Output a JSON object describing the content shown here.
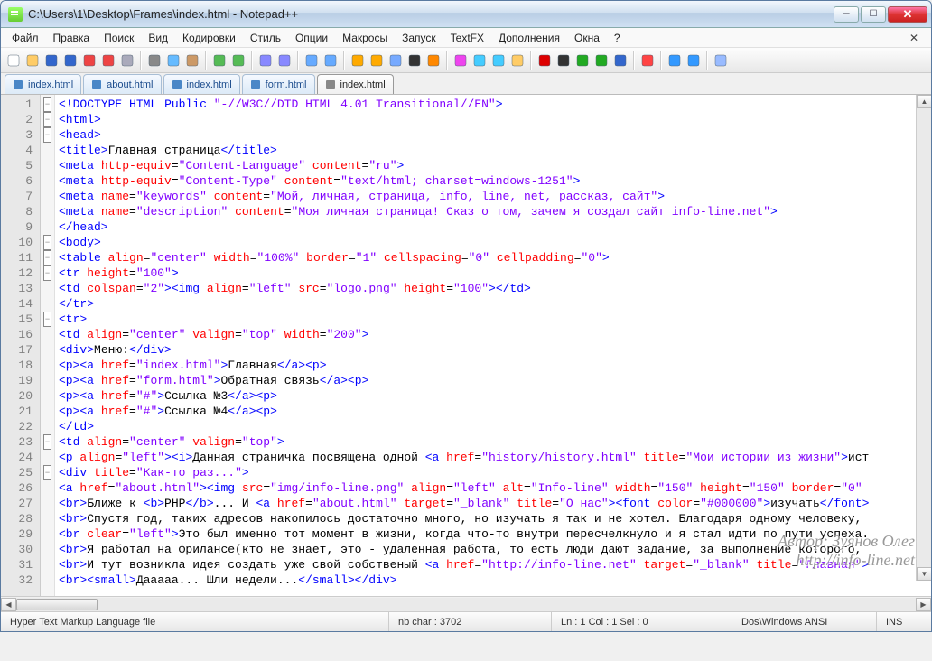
{
  "window": {
    "title": "C:\\Users\\1\\Desktop\\Frames\\index.html - Notepad++"
  },
  "menu": {
    "items": [
      "Файл",
      "Правка",
      "Поиск",
      "Вид",
      "Кодировки",
      "Стиль",
      "Опции",
      "Макросы",
      "Запуск",
      "TextFX",
      "Дополнения",
      "Окна",
      "?"
    ],
    "close_glyph": "✕"
  },
  "toolbar_icons": [
    "new-file",
    "open-file",
    "save-file",
    "save-all",
    "close-file",
    "close-all",
    "print",
    "sep",
    "cut",
    "copy",
    "paste",
    "sep",
    "undo",
    "redo",
    "sep",
    "find",
    "replace",
    "sep",
    "zoom-in",
    "zoom-out",
    "sep",
    "sync-v",
    "sync-h",
    "wrap",
    "all-chars",
    "indent-guide",
    "sep",
    "lang-udl",
    "doc-map",
    "func-list",
    "folder",
    "sep",
    "macro-rec",
    "macro-stop",
    "macro-play",
    "macro-play-multi",
    "macro-save",
    "sep",
    "toggle-ff",
    "sep",
    "outdent",
    "indent",
    "sep",
    "clipboard-hist"
  ],
  "tabs": [
    {
      "label": "index.html",
      "active": false
    },
    {
      "label": "about.html",
      "active": false
    },
    {
      "label": "index.html",
      "active": false
    },
    {
      "label": "form.html",
      "active": false
    },
    {
      "label": "index.html",
      "active": true
    }
  ],
  "line_count_start": 1,
  "fold_lines": [
    1,
    2,
    3,
    10,
    11,
    12,
    15,
    23,
    25
  ],
  "code_lines": [
    {
      "indent": 0,
      "html": "<span class='t-blue'>&lt;!</span><span class='t-blue'>DOCTYPE</span> <span class='t-blue'>HTML</span> <span class='t-blue'>Public</span> <span class='t-purple'>\"-//W3C//DTD HTML 4.01 Transitional//EN\"</span><span class='t-blue'>&gt;</span>"
    },
    {
      "indent": 0,
      "html": "<span class='t-blue'>&lt;html&gt;</span>"
    },
    {
      "indent": 0,
      "html": "<span class='t-blue'>&lt;head&gt;</span>"
    },
    {
      "indent": 0,
      "html": "<span class='t-blue'>&lt;title&gt;</span><span class='t-black'>Главная страница</span><span class='t-blue'>&lt;/title&gt;</span>"
    },
    {
      "indent": 0,
      "html": "<span class='t-blue'>&lt;meta</span> <span class='t-red'>http-equiv</span>=<span class='t-purple'>\"Content-Language\"</span> <span class='t-red'>content</span>=<span class='t-purple'>\"ru\"</span><span class='t-blue'>&gt;</span>"
    },
    {
      "indent": 0,
      "html": "<span class='t-blue'>&lt;meta</span> <span class='t-red'>http-equiv</span>=<span class='t-purple'>\"Content-Type\"</span> <span class='t-red'>content</span>=<span class='t-purple'>\"text/html; charset=windows-1251\"</span><span class='t-blue'>&gt;</span>"
    },
    {
      "indent": 0,
      "html": "<span class='t-blue'>&lt;meta</span> <span class='t-red'>name</span>=<span class='t-purple'>\"keywords\"</span> <span class='t-red'>content</span>=<span class='t-purple'>\"Мой, личная, страница, info, line, net, рассказ, сайт\"</span><span class='t-blue'>&gt;</span>"
    },
    {
      "indent": 0,
      "html": "<span class='t-blue'>&lt;meta</span> <span class='t-red'>name</span>=<span class='t-purple'>\"description\"</span> <span class='t-red'>content</span>=<span class='t-purple'>\"Моя личная страница! Сказ о том, зачем я создал сайт info-line.net\"</span><span class='t-blue'>&gt;</span>"
    },
    {
      "indent": 0,
      "html": "<span class='t-blue'>&lt;/head&gt;</span>"
    },
    {
      "indent": 0,
      "html": "<span class='t-blue'>&lt;body&gt;</span>"
    },
    {
      "indent": 0,
      "html": "<span class='t-blue'>&lt;table</span> <span class='t-red'>align</span>=<span class='t-purple'>\"center\"</span> <span class='t-red'>wi<span class='caret'></span>dth</span>=<span class='t-purple'>\"100%\"</span> <span class='t-red'>border</span>=<span class='t-purple'>\"1\"</span> <span class='t-red'>cellspacing</span>=<span class='t-purple'>\"0\"</span> <span class='t-red'>cellpadding</span>=<span class='t-purple'>\"0\"</span><span class='t-blue'>&gt;</span>"
    },
    {
      "indent": 0,
      "html": "<span class='t-blue'>&lt;tr</span> <span class='t-red'>height</span>=<span class='t-purple'>\"100\"</span><span class='t-blue'>&gt;</span>"
    },
    {
      "indent": 0,
      "html": "<span class='t-blue'>&lt;td</span> <span class='t-red'>colspan</span>=<span class='t-purple'>\"2\"</span><span class='t-blue'>&gt;&lt;img</span> <span class='t-red'>align</span>=<span class='t-purple'>\"left\"</span> <span class='t-red'>src</span>=<span class='t-purple'>\"logo.png\"</span> <span class='t-red'>height</span>=<span class='t-purple'>\"100\"</span><span class='t-blue'>&gt;&lt;/td&gt;</span>"
    },
    {
      "indent": 0,
      "html": "<span class='t-blue'>&lt;/tr&gt;</span>"
    },
    {
      "indent": 0,
      "html": "<span class='t-blue'>&lt;tr&gt;</span>"
    },
    {
      "indent": 0,
      "html": "<span class='t-blue'>&lt;td</span> <span class='t-red'>align</span>=<span class='t-purple'>\"center\"</span> <span class='t-red'>valign</span>=<span class='t-purple'>\"top\"</span> <span class='t-red'>width</span>=<span class='t-purple'>\"200\"</span><span class='t-blue'>&gt;</span>"
    },
    {
      "indent": 0,
      "html": "<span class='t-blue'>&lt;div&gt;</span><span class='t-black'>Меню:</span><span class='t-blue'>&lt;/div&gt;</span>"
    },
    {
      "indent": 0,
      "html": "<span class='t-blue'>&lt;p&gt;&lt;a</span> <span class='t-red'>href</span>=<span class='t-purple'>\"index.html\"</span><span class='t-blue'>&gt;</span><span class='t-black'>Главная</span><span class='t-blue'>&lt;/a&gt;&lt;p&gt;</span>"
    },
    {
      "indent": 0,
      "html": "<span class='t-blue'>&lt;p&gt;&lt;a</span> <span class='t-red'>href</span>=<span class='t-purple'>\"form.html\"</span><span class='t-blue'>&gt;</span><span class='t-black'>Обратная связь</span><span class='t-blue'>&lt;/a&gt;&lt;p&gt;</span>"
    },
    {
      "indent": 0,
      "html": "<span class='t-blue'>&lt;p&gt;&lt;a</span> <span class='t-red'>href</span>=<span class='t-purple'>\"#\"</span><span class='t-blue'>&gt;</span><span class='t-black'>Ссылка №3</span><span class='t-blue'>&lt;/a&gt;&lt;p&gt;</span>"
    },
    {
      "indent": 0,
      "html": "<span class='t-blue'>&lt;p&gt;&lt;a</span> <span class='t-red'>href</span>=<span class='t-purple'>\"#\"</span><span class='t-blue'>&gt;</span><span class='t-black'>Ссылка №4</span><span class='t-blue'>&lt;/a&gt;&lt;p&gt;</span>"
    },
    {
      "indent": 0,
      "html": "<span class='t-blue'>&lt;/td&gt;</span>"
    },
    {
      "indent": 0,
      "html": "<span class='t-blue'>&lt;td</span> <span class='t-red'>align</span>=<span class='t-purple'>\"center\"</span> <span class='t-red'>valign</span>=<span class='t-purple'>\"top\"</span><span class='t-blue'>&gt;</span>"
    },
    {
      "indent": 0,
      "html": "<span class='t-blue'>&lt;p</span> <span class='t-red'>align</span>=<span class='t-purple'>\"left\"</span><span class='t-blue'>&gt;&lt;i&gt;</span><span class='t-black'>Данная страничка посвящена одной </span><span class='t-blue'>&lt;a</span> <span class='t-red'>href</span>=<span class='t-purple'>\"history/history.html\"</span> <span class='t-red'>title</span>=<span class='t-purple'>\"Мои истории из жизни\"</span><span class='t-blue'>&gt;</span><span class='t-black'>ист</span>"
    },
    {
      "indent": 0,
      "html": "<span class='t-blue'>&lt;div</span> <span class='t-red'>title</span>=<span class='t-purple'>\"Как-то раз...\"</span><span class='t-blue'>&gt;</span>"
    },
    {
      "indent": 0,
      "html": "<span class='t-blue'>&lt;a</span> <span class='t-red'>href</span>=<span class='t-purple'>\"about.html\"</span><span class='t-blue'>&gt;&lt;img</span> <span class='t-red'>src</span>=<span class='t-purple'>\"img/info-line.png\"</span> <span class='t-red'>align</span>=<span class='t-purple'>\"left\"</span> <span class='t-red'>alt</span>=<span class='t-purple'>\"Info-line\"</span> <span class='t-red'>width</span>=<span class='t-purple'>\"150\"</span> <span class='t-red'>height</span>=<span class='t-purple'>\"150\"</span> <span class='t-red'>border</span>=<span class='t-purple'>\"0\"</span>"
    },
    {
      "indent": 0,
      "html": "<span class='t-blue'>&lt;br&gt;</span><span class='t-black'>Ближе к </span><span class='t-blue'>&lt;b&gt;</span><span class='t-black'>PHP</span><span class='t-blue'>&lt;/b&gt;</span><span class='t-black'>... И </span><span class='t-blue'>&lt;a</span> <span class='t-red'>href</span>=<span class='t-purple'>\"about.html\"</span> <span class='t-red'>target</span>=<span class='t-purple'>\"_blank\"</span> <span class='t-red'>title</span>=<span class='t-purple'>\"О нас\"</span><span class='t-blue'>&gt;&lt;font</span> <span class='t-red'>color</span>=<span class='t-purple'>\"#000000\"</span><span class='t-blue'>&gt;</span><span class='t-black'>изучать</span><span class='t-blue'>&lt;/font&gt;</span>"
    },
    {
      "indent": 0,
      "html": "<span class='t-blue'>&lt;br&gt;</span><span class='t-black'>Спустя год, таких адресов накопилось достаточно много, но изучать я так и не хотел. Благодаря одному человеку,</span>"
    },
    {
      "indent": 0,
      "html": "<span class='t-blue'>&lt;br</span> <span class='t-red'>clear</span>=<span class='t-purple'>\"left\"</span><span class='t-blue'>&gt;</span><span class='t-black'>Это был именно тот момент в жизни, когда что-то внутри пересчелкнуло и я стал идти по пути успеха.</span>"
    },
    {
      "indent": 0,
      "html": "<span class='t-blue'>&lt;br&gt;</span><span class='t-black'>Я работал на фрилансе(кто не знает, это - удаленная работа, то есть люди дают задание, за выполнение которого,</span>"
    },
    {
      "indent": 0,
      "html": "<span class='t-blue'>&lt;br&gt;</span><span class='t-black'>И тут возникла идея создать уже свой собственый </span><span class='t-blue'>&lt;a</span> <span class='t-red'>href</span>=<span class='t-purple'>\"http://info-line.net\"</span> <span class='t-red'>target</span>=<span class='t-purple'>\"_blank\"</span> <span class='t-red'>title</span>=<span class='t-purple'>\"Главная\"</span><span class='t-blue'>&gt;</span>"
    },
    {
      "indent": 0,
      "html": "<span class='t-blue'>&lt;br&gt;&lt;small&gt;</span><span class='t-black'>Дааааа... Шли недели...</span><span class='t-blue'>&lt;/small&gt;&lt;/div&gt;</span>"
    }
  ],
  "status": {
    "filetype": "Hyper Text Markup Language file",
    "nbchar": "nb char : 3702",
    "pos": "Ln : 1   Col : 1   Sel : 0",
    "enc": "Dos\\Windows   ANSI",
    "ins": "INS"
  },
  "watermark": {
    "line1": "Автор: Зуянов Олег",
    "line2": "http://info-line.net"
  }
}
